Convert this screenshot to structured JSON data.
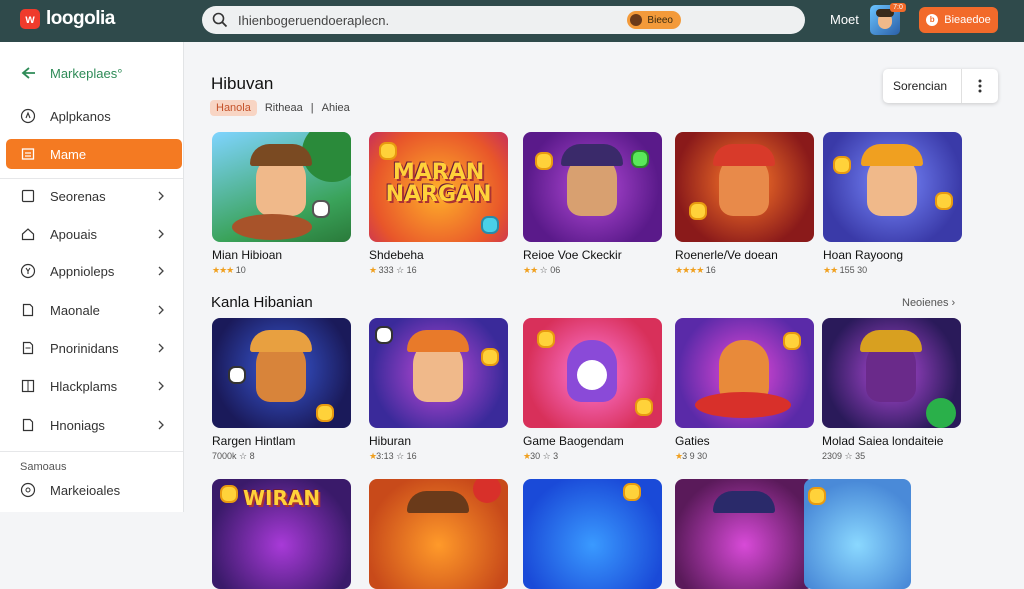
{
  "topbar": {
    "logo_text": "loogolia",
    "search_text": "Ihienbogeruendoeraplecn.",
    "search_pill_label": "Bieeo",
    "link_label": "Moet",
    "avatar_badge": "7:0",
    "button_label": "Bieaedoe"
  },
  "sidebar": {
    "items": [
      {
        "label": "Markeplaes°"
      },
      {
        "label": "Aplpkanos"
      },
      {
        "label": "Mame"
      },
      {
        "label": "Seorenas"
      },
      {
        "label": "Apouais"
      },
      {
        "label": "Appnioleps"
      },
      {
        "label": "Maonale"
      },
      {
        "label": "Pnorinidans"
      },
      {
        "label": "Hlackplams"
      },
      {
        "label": "Hnoniags"
      }
    ],
    "section_label": "Samoaus",
    "bottom_item": "Markeioales"
  },
  "main": {
    "title": "Hibuvan",
    "chips": [
      "Hanola",
      "Ritheaa",
      "Ahiea"
    ],
    "sort_label": "Sorencian",
    "section2_title": "Kanla Hibanian",
    "see_more": "Neoienes ›",
    "row1": [
      {
        "title": "Mian Hibioan",
        "stars": "★★★",
        "meta": "10"
      },
      {
        "title": "Shdebeha",
        "stars": "★",
        "meta": "333 ☆ 16"
      },
      {
        "title": "Reioe Voe Ckeckir",
        "stars": "★★",
        "meta": "☆ 06"
      },
      {
        "title": "Roenerle/Ve doean",
        "stars": "★★★★",
        "meta": "16"
      },
      {
        "title": "Hoan Rayoong",
        "stars": "★★",
        "meta": "155 30"
      }
    ],
    "row2": [
      {
        "title": "Rargen Hintlam",
        "stars": "",
        "meta": "7000k ☆ 8"
      },
      {
        "title": "Hiburan",
        "stars": "★",
        "meta": "3:13 ☆ 16"
      },
      {
        "title": "Game Baogendam",
        "stars": "★",
        "meta": "30 ☆ 3"
      },
      {
        "title": "Gaties",
        "stars": "★",
        "meta": "3 9 30"
      },
      {
        "title": "Molad Saiea londaiteie",
        "stars": "",
        "meta": "2309 ☆ 35"
      }
    ],
    "thumb_texts": [
      "MARAN NARGAN",
      "WIRAN"
    ]
  },
  "colors": {
    "topbar": "#2f4a4b",
    "accent": "#f47a22",
    "market_green": "#2e8b57"
  },
  "icons": [
    "search-icon",
    "marketplace-icon",
    "apps-icon",
    "home-icon",
    "list-icon",
    "home-alt-icon",
    "settings-icon",
    "file-icon",
    "file-alt-icon",
    "grid-icon",
    "folder-icon",
    "chevron-right-icon",
    "more-vertical-icon"
  ]
}
